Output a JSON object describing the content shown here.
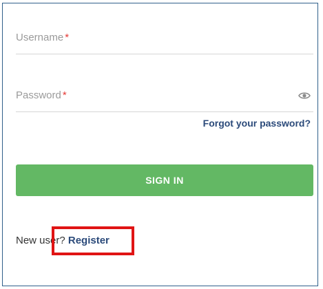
{
  "login_form": {
    "username": {
      "label": "Username",
      "required_mark": "*",
      "value": ""
    },
    "password": {
      "label": "Password",
      "required_mark": "*",
      "value": "",
      "toggle_icon": "eye-icon"
    },
    "forgot_password_label": "Forgot your password?",
    "sign_in_label": "SIGN IN",
    "new_user_text": "New user?",
    "register_label": "Register"
  },
  "colors": {
    "primary_button": "#63b864",
    "link": "#2b4a7a",
    "required": "#e53935",
    "highlight": "#e01414",
    "frame_border": "#2e5f8a"
  }
}
